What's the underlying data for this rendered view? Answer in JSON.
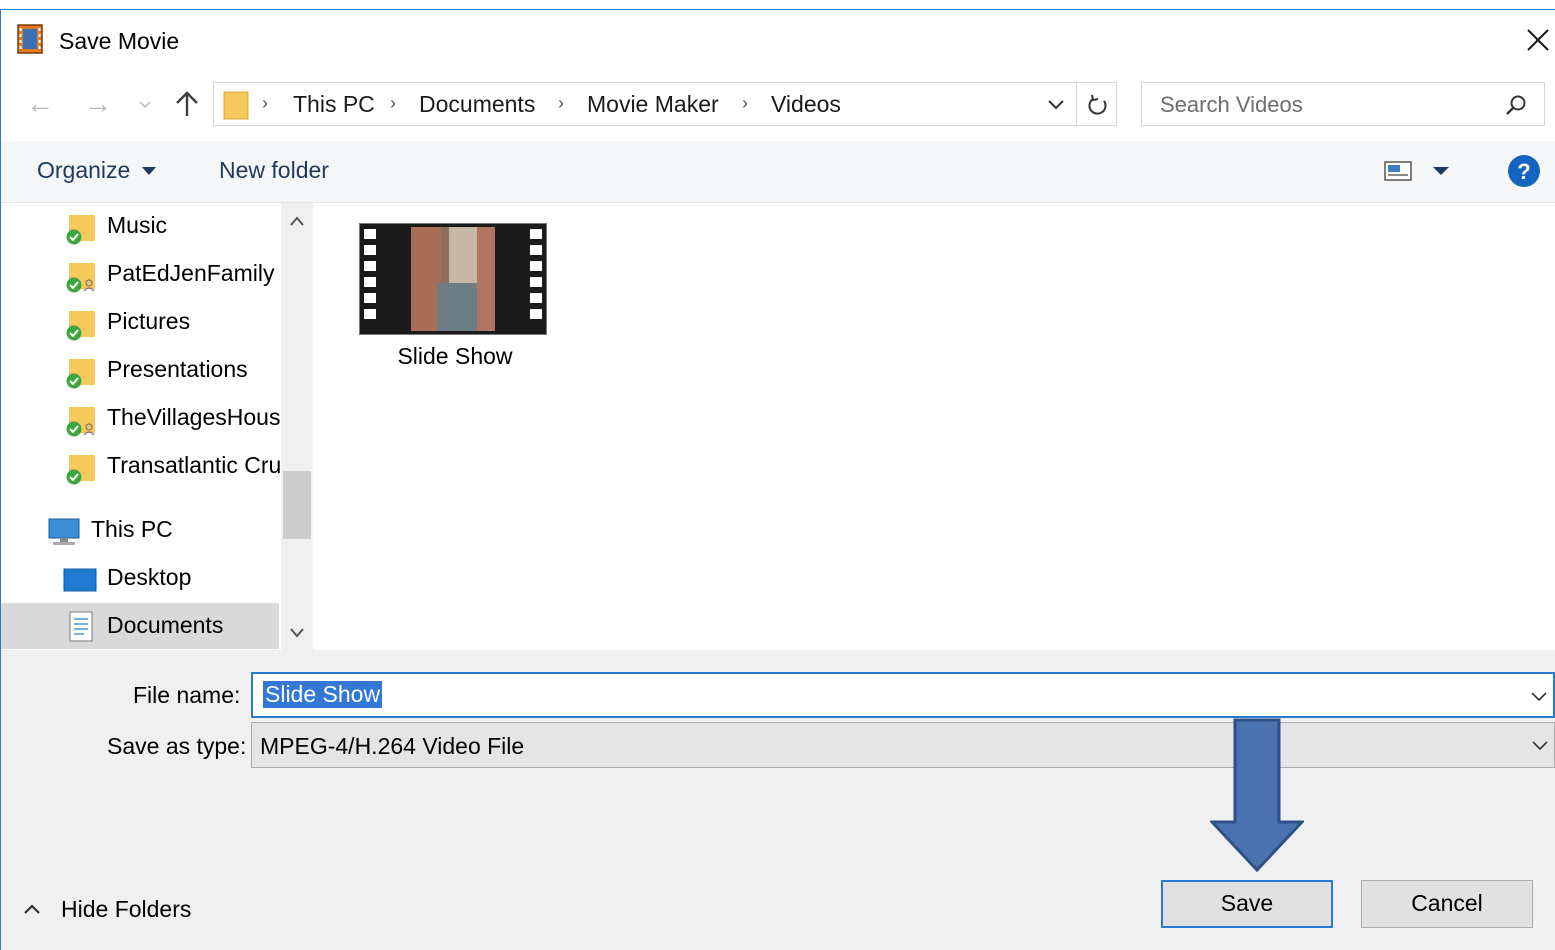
{
  "window": {
    "title": "Save Movie"
  },
  "address": {
    "crumbs": [
      "This PC",
      "Documents",
      "Movie Maker",
      "Videos"
    ]
  },
  "search": {
    "placeholder": "Search Videos"
  },
  "toolbar": {
    "organize_label": "Organize",
    "new_folder_label": "New folder"
  },
  "nav": {
    "items": [
      {
        "label": "Music"
      },
      {
        "label": "PatEdJenFamily"
      },
      {
        "label": "Pictures"
      },
      {
        "label": "Presentations"
      },
      {
        "label": "TheVillagesHous"
      },
      {
        "label": "Transatlantic Cru"
      },
      {
        "label": "This PC"
      },
      {
        "label": "Desktop"
      },
      {
        "label": "Documents"
      }
    ]
  },
  "content": {
    "files": [
      {
        "label": "Slide Show"
      }
    ]
  },
  "form": {
    "file_name_label": "File name:",
    "file_name_value": "Slide Show",
    "save_type_label": "Save as type:",
    "save_type_value": "MPEG-4/H.264 Video File"
  },
  "buttons": {
    "save_label": "Save",
    "cancel_label": "Cancel",
    "hide_folders_label": "Hide Folders"
  },
  "colors": {
    "accent": "#2b79d3",
    "arrow_fill": "#4a72b0",
    "arrow_stroke": "#2f4f86",
    "folder": "#f5c95c",
    "check": "#3fa640"
  }
}
